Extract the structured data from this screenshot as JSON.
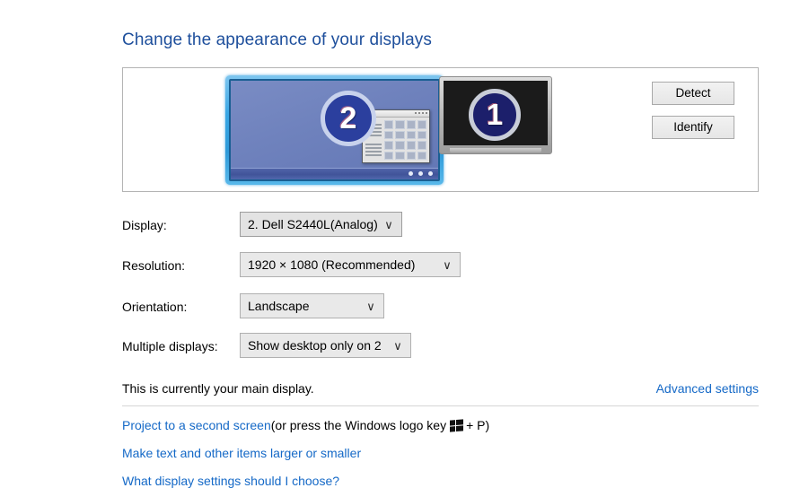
{
  "page": {
    "title": "Change the appearance of your displays"
  },
  "preview": {
    "monitors": [
      {
        "number": "2",
        "name": "monitor-2",
        "selected": true,
        "state": "active-blue-desktop"
      },
      {
        "number": "1",
        "name": "monitor-1",
        "selected": false,
        "state": "black-screen"
      }
    ],
    "buttons": {
      "detect": "Detect",
      "identify": "Identify"
    }
  },
  "settings": {
    "display": {
      "label": "Display:",
      "value": "2. Dell S2440L(Analog)",
      "chevron": "∨"
    },
    "resolution": {
      "label": "Resolution:",
      "value": "1920 × 1080 (Recommended)",
      "chevron": "∨"
    },
    "orientation": {
      "label": "Orientation:",
      "value": "Landscape",
      "chevron": "∨"
    },
    "multiple_displays": {
      "label": "Multiple displays:",
      "value": "Show desktop only on 2",
      "chevron": "∨"
    }
  },
  "status": {
    "main_display_text": "This is currently your main display.",
    "advanced_settings_link": "Advanced settings"
  },
  "footer": {
    "project_link": "Project to a second screen",
    "project_suffix_before_key": " (or press the Windows logo key",
    "project_suffix_after_key": "+ P)",
    "make_text_link": "Make text and other items larger or smaller",
    "what_settings_link": "What display settings should I choose?"
  },
  "colors": {
    "title_blue": "#1e4f9c",
    "link_blue": "#1569c7",
    "selected_monitor_glow": "#39a7e5",
    "monitor2_desktop": "#6f82bd",
    "badge_fill": "#2b3f9e",
    "panel_border": "#b4b4b4"
  }
}
